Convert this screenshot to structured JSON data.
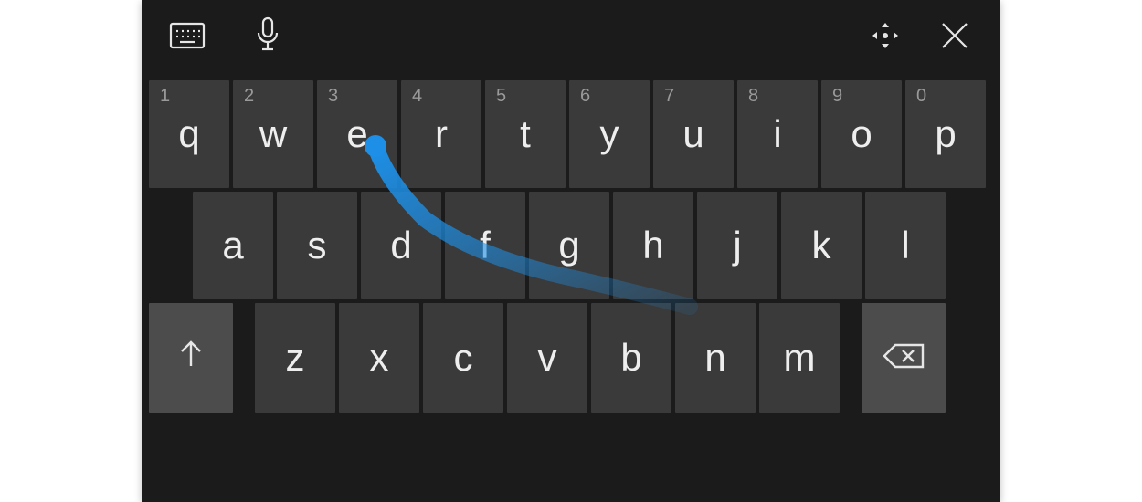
{
  "toolbar": {
    "layout_icon": "keyboard-layout-icon",
    "mic_icon": "microphone-icon",
    "move_icon": "move-handle-icon",
    "close_icon": "close-icon"
  },
  "rows": {
    "r1": [
      {
        "l": "q",
        "n": "1"
      },
      {
        "l": "w",
        "n": "2"
      },
      {
        "l": "e",
        "n": "3"
      },
      {
        "l": "r",
        "n": "4"
      },
      {
        "l": "t",
        "n": "5"
      },
      {
        "l": "y",
        "n": "6"
      },
      {
        "l": "u",
        "n": "7"
      },
      {
        "l": "i",
        "n": "8"
      },
      {
        "l": "o",
        "n": "9"
      },
      {
        "l": "p",
        "n": "0"
      }
    ],
    "r2": [
      {
        "l": "a"
      },
      {
        "l": "s"
      },
      {
        "l": "d"
      },
      {
        "l": "f"
      },
      {
        "l": "g"
      },
      {
        "l": "h"
      },
      {
        "l": "j"
      },
      {
        "l": "k"
      },
      {
        "l": "l"
      }
    ],
    "r3_letters": [
      {
        "l": "z"
      },
      {
        "l": "x"
      },
      {
        "l": "c"
      },
      {
        "l": "v"
      },
      {
        "l": "b"
      },
      {
        "l": "n"
      },
      {
        "l": "m"
      }
    ]
  },
  "fn": {
    "shift": "shift-key",
    "backspace": "backspace-key"
  },
  "swipe": {
    "color": "#1d8fe6",
    "start_key": "e",
    "toward_key": "h"
  }
}
